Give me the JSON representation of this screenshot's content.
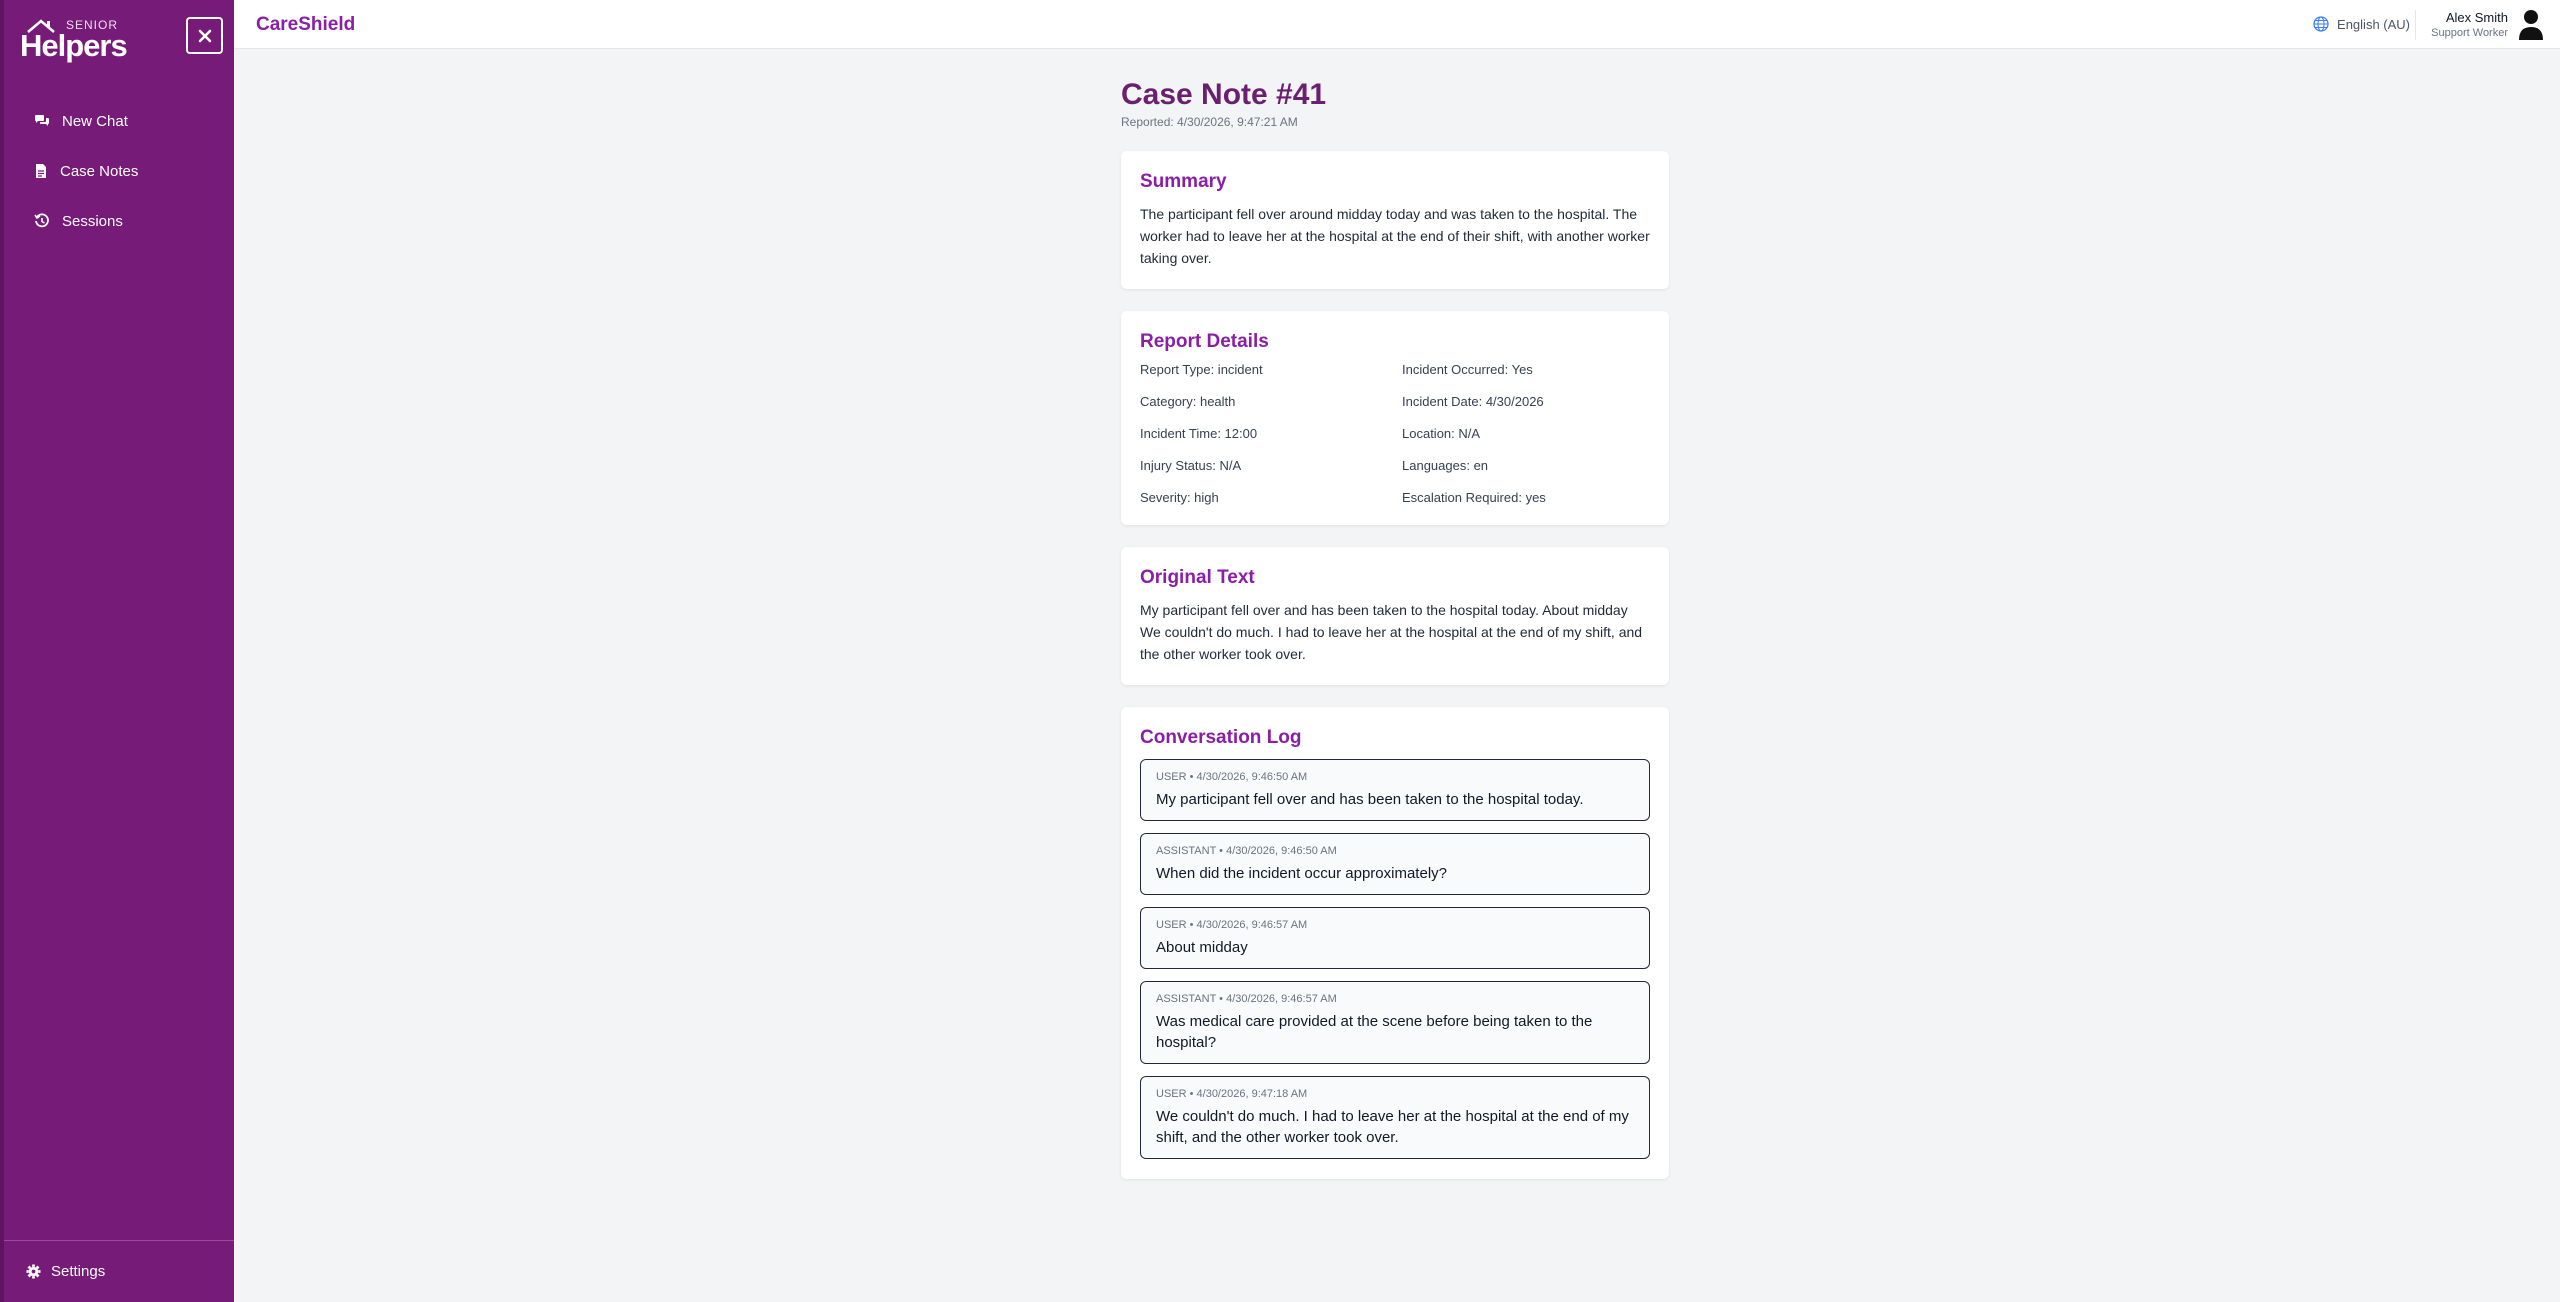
{
  "sidebar": {
    "logo_small": "SENIOR",
    "logo_main": "Helpers",
    "nav": [
      {
        "label": "New Chat",
        "icon": "chat-bubbles-icon"
      },
      {
        "label": "Case Notes",
        "icon": "document-icon"
      },
      {
        "label": "Sessions",
        "icon": "history-icon"
      }
    ],
    "settings_label": "Settings"
  },
  "header": {
    "brand": "CareShield",
    "language": "English (AU)",
    "user_name": "Alex Smith",
    "user_role": "Support Worker"
  },
  "case": {
    "title": "Case Note #41",
    "reported": "Reported: 4/30/2026, 9:47:21 AM"
  },
  "summary": {
    "heading": "Summary",
    "text": "The participant fell over around midday today and was taken to the hospital. The worker had to leave her at the hospital at the end of their shift, with another worker taking over."
  },
  "report_details": {
    "heading": "Report Details",
    "items": [
      "Report Type: incident",
      "Incident Occurred: Yes",
      "Category: health",
      "Incident Date: 4/30/2026",
      "Incident Time: 12:00",
      "Location: N/A",
      "Injury Status: N/A",
      "Languages: en",
      "Severity: high",
      "Escalation Required: yes"
    ]
  },
  "original_text": {
    "heading": "Original Text",
    "text": "My participant fell over and has been taken to the hospital today. About midday We couldn't do much. I had to leave her at the hospital at the end of my shift, and the other worker took over."
  },
  "conversation": {
    "heading": "Conversation Log",
    "messages": [
      {
        "meta": "USER • 4/30/2026, 9:46:50 AM",
        "text": "My participant fell over and has been taken to the hospital today."
      },
      {
        "meta": "ASSISTANT • 4/30/2026, 9:46:50 AM",
        "text": "When did the incident occur approximately?"
      },
      {
        "meta": "USER • 4/30/2026, 9:46:57 AM",
        "text": "About midday"
      },
      {
        "meta": "ASSISTANT • 4/30/2026, 9:46:57 AM",
        "text": "Was medical care provided at the scene before being taken to the hospital?"
      },
      {
        "meta": "USER • 4/30/2026, 9:47:18 AM",
        "text": "We couldn't do much. I had to leave her at the hospital at the end of my shift, and the other worker took over."
      }
    ]
  },
  "colors": {
    "sidebar": "#771b79",
    "accent": "#8a1ea6",
    "title": "#6b1f70"
  }
}
